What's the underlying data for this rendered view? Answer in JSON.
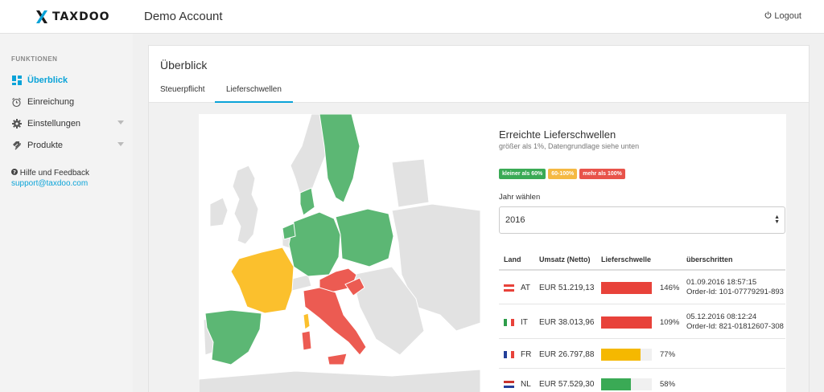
{
  "app": {
    "brand": "TAXDOO",
    "account": "Demo Account",
    "logout": "Logout"
  },
  "sidebar": {
    "heading": "FUNKTIONEN",
    "items": [
      {
        "label": "Überblick",
        "icon": "dashboard-icon",
        "active": true
      },
      {
        "label": "Einreichung",
        "icon": "alarm-clock-icon"
      },
      {
        "label": "Einstellungen",
        "icon": "gear-icon",
        "expandable": true
      },
      {
        "label": "Produkte",
        "icon": "tag-icon",
        "expandable": true
      }
    ],
    "help_label": "Hilfe und Feedback",
    "help_email": "support@taxdoo.com"
  },
  "main": {
    "title": "Überblick",
    "tabs": [
      {
        "label": "Steuerpflicht",
        "active": false
      },
      {
        "label": "Lieferschwellen",
        "active": true
      }
    ]
  },
  "card": {
    "title": "Erreichte Lieferschwellen",
    "subtitle": "größer als 1%, Datengrundlage siehe unten",
    "legend": [
      {
        "label": "kleiner als 60%",
        "color": "#3aaa55"
      },
      {
        "label": "60-100%",
        "color": "#f5b942"
      },
      {
        "label": "mehr als 100%",
        "color": "#e8534a"
      }
    ],
    "year_label": "Jahr wählen",
    "year_value": "2016",
    "columns": [
      "Land",
      "Umsatz (Netto)",
      "Lieferschwelle",
      "überschritten"
    ],
    "rows": [
      {
        "code": "AT",
        "amount": "EUR 51.219,13",
        "percent_label": "146%",
        "percent": 146,
        "color": "#e8423a",
        "date": "01.09.2016 18:57:15",
        "order": "Order-Id: 101-07779291-893"
      },
      {
        "code": "IT",
        "amount": "EUR 38.013,96",
        "percent_label": "109%",
        "percent": 109,
        "color": "#e8423a",
        "date": "05.12.2016 08:12:24",
        "order": "Order-Id: 821-01812607-308"
      },
      {
        "code": "FR",
        "amount": "EUR 26.797,88",
        "percent_label": "77%",
        "percent": 77,
        "color": "#f5b800",
        "date": "",
        "order": ""
      },
      {
        "code": "NL",
        "amount": "EUR 57.529,30",
        "percent_label": "58%",
        "percent": 58,
        "color": "#3aaa55",
        "date": "",
        "order": ""
      }
    ]
  },
  "colors": {
    "accent": "#0aa3d8",
    "green": "#5cb774",
    "yellow": "#fbc02d",
    "red": "#ec5b52"
  }
}
